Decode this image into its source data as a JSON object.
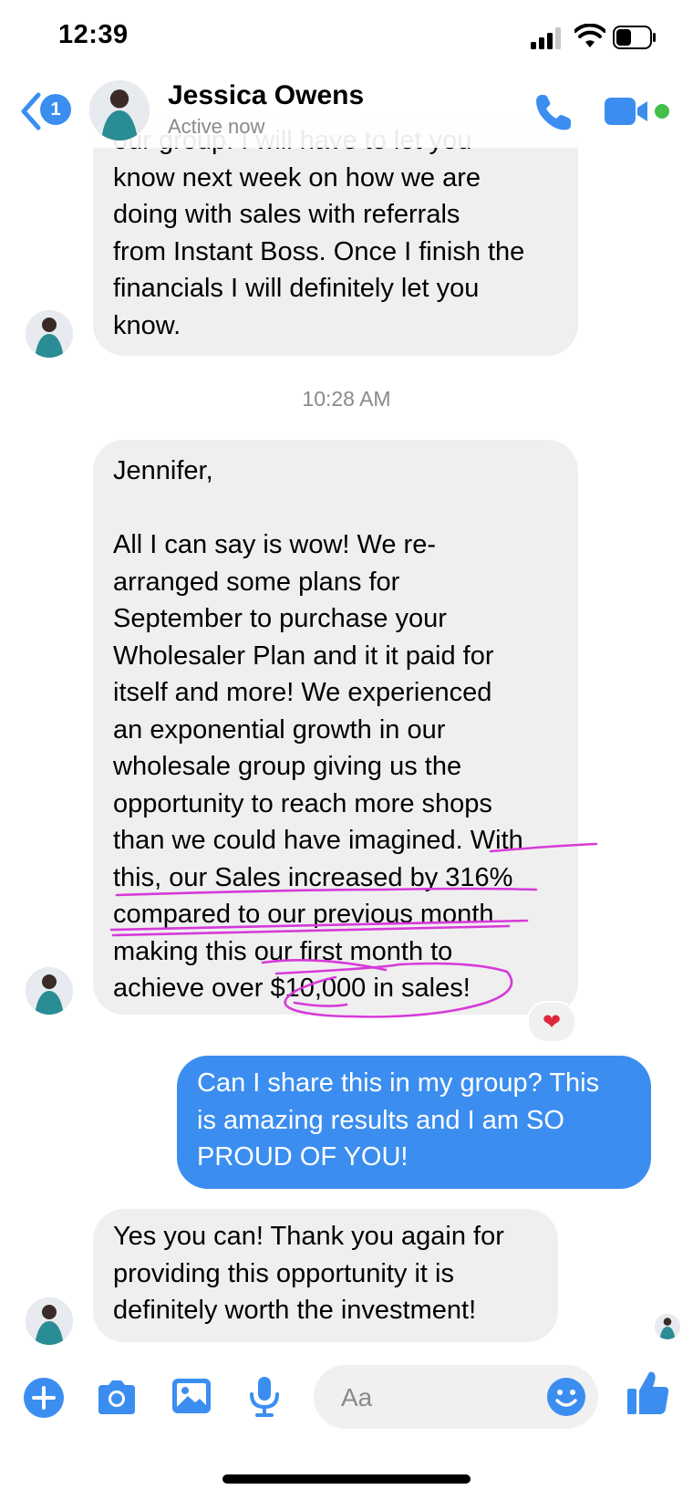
{
  "status_bar": {
    "time": "12:39"
  },
  "header": {
    "back_badge_count": "1",
    "contact_name": "Jessica Owens",
    "status": "Active now"
  },
  "messages": [
    {
      "direction": "incoming",
      "text": "our group. I will have to let you\nknow next week on how we are\ndoing with sales with referrals\nfrom Instant Boss. Once I finish the\nfinancials I will definitely let you\nknow."
    },
    {
      "direction": "incoming",
      "text": "Jennifer,\n\nAll I can say is wow! We re-\narranged some plans for\nSeptember to purchase your\nWholesaler Plan and it it paid for\nitself and more! We experienced\nan exponential growth in our\nwholesale group giving us the\nopportunity to reach more shops\nthan we could have imagined. With\nthis, our Sales increased by 316%\ncompared to our previous month\nmaking this our first month to\nachieve over $10,000 in sales!",
      "reaction": "❤"
    },
    {
      "direction": "outgoing",
      "text": "Can I share this in my group? This\nis amazing results and I am SO\nPROUD OF YOU!"
    },
    {
      "direction": "incoming",
      "text": "Yes you can! Thank you again for\nproviding this opportunity it is\ndefinitely worth the investment!"
    }
  ],
  "timestamp": "10:28 AM",
  "composer": {
    "placeholder": "Aa"
  },
  "icons": {
    "back": "chevron-left-icon",
    "call": "phone-icon",
    "video": "video-camera-icon",
    "add": "plus-icon",
    "camera": "camera-icon",
    "gallery": "image-icon",
    "voice": "microphone-icon",
    "emoji": "smiley-icon",
    "like": "thumbs-up-icon"
  },
  "colors": {
    "accent": "#3b8ef0",
    "incoming_bubble": "#efefef",
    "highlight_annotation": "#d63ad9",
    "online": "#44c04a"
  }
}
